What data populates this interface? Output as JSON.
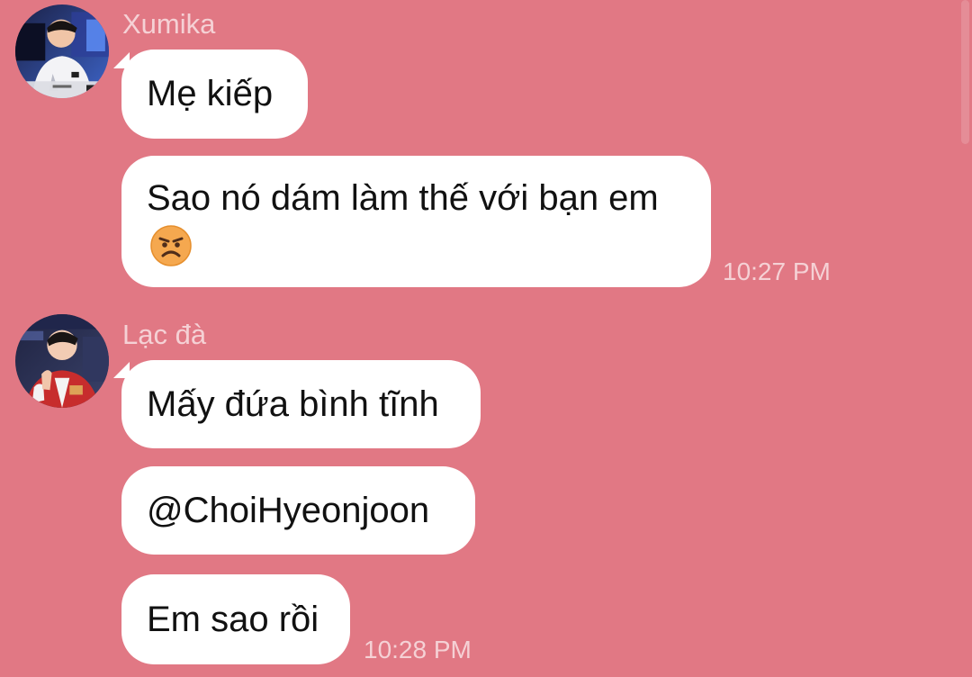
{
  "messages": [
    {
      "sender": "Xumika",
      "bubbles": [
        {
          "text": "Mẹ kiếp"
        },
        {
          "text": "Sao nó dám làm thế với bạn em",
          "emoji": "angry-face-icon"
        }
      ],
      "time": "10:27 PM"
    },
    {
      "sender": "Lạc đà",
      "bubbles": [
        {
          "text": "Mấy đứa bình tĩnh"
        },
        {
          "text": "@ChoiHyeonjoon"
        },
        {
          "text": "Em sao rồi"
        }
      ],
      "time": "10:28 PM"
    }
  ],
  "theme": {
    "background": "#e17884",
    "bubble": "#ffffff",
    "text": "#111111"
  }
}
